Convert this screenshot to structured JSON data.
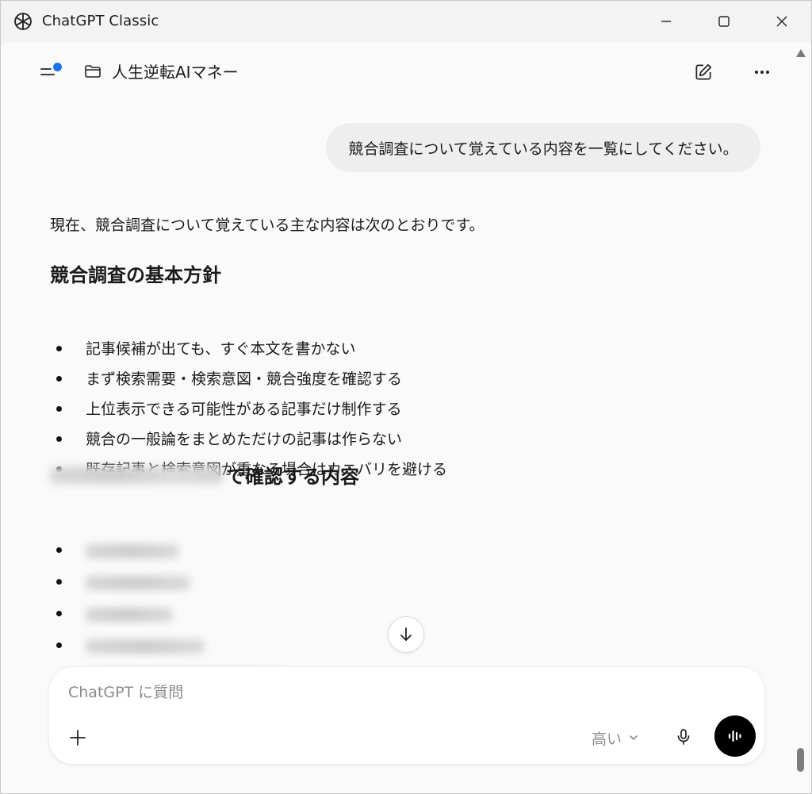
{
  "window": {
    "title": "ChatGPT Classic"
  },
  "header": {
    "project_name": "人生逆転AIマネー"
  },
  "conversation": {
    "user_message": "競合調査について覚えている内容を一覧にしてください。",
    "assistant": {
      "intro": "現在、競合調査について覚えている主な内容は次のとおりです。",
      "section1_heading": "競合調査の基本方針",
      "section1_items": [
        "記事候補が出ても、すぐ本文を書かない",
        "まず検索需要・検索意図・競合強度を確認する",
        "上位表示できる可能性がある記事だけ制作する",
        "競合の一般論をまとめただけの記事は作らない",
        "既存記事と検索意図が重なる場合はカニバリを避ける"
      ],
      "section2_heading_suffix": "で確認する内容",
      "section2_item_count": 5
    }
  },
  "composer": {
    "placeholder": "ChatGPT に質問",
    "model_label": "高い"
  },
  "icons": {
    "app": "chatgpt-logo-icon",
    "sidebar": "sidebar-toggle-icon",
    "folder": "folder-icon",
    "edit": "new-chat-icon",
    "more": "more-icon",
    "scroll": "arrow-down-icon",
    "plus": "plus-icon",
    "chevron": "chevron-down-icon",
    "mic": "microphone-icon",
    "voice": "voice-mode-icon"
  },
  "colors": {
    "notification_dot": "#1a73e8",
    "voice_button": "#000000",
    "user_bubble": "#eeeeee"
  }
}
